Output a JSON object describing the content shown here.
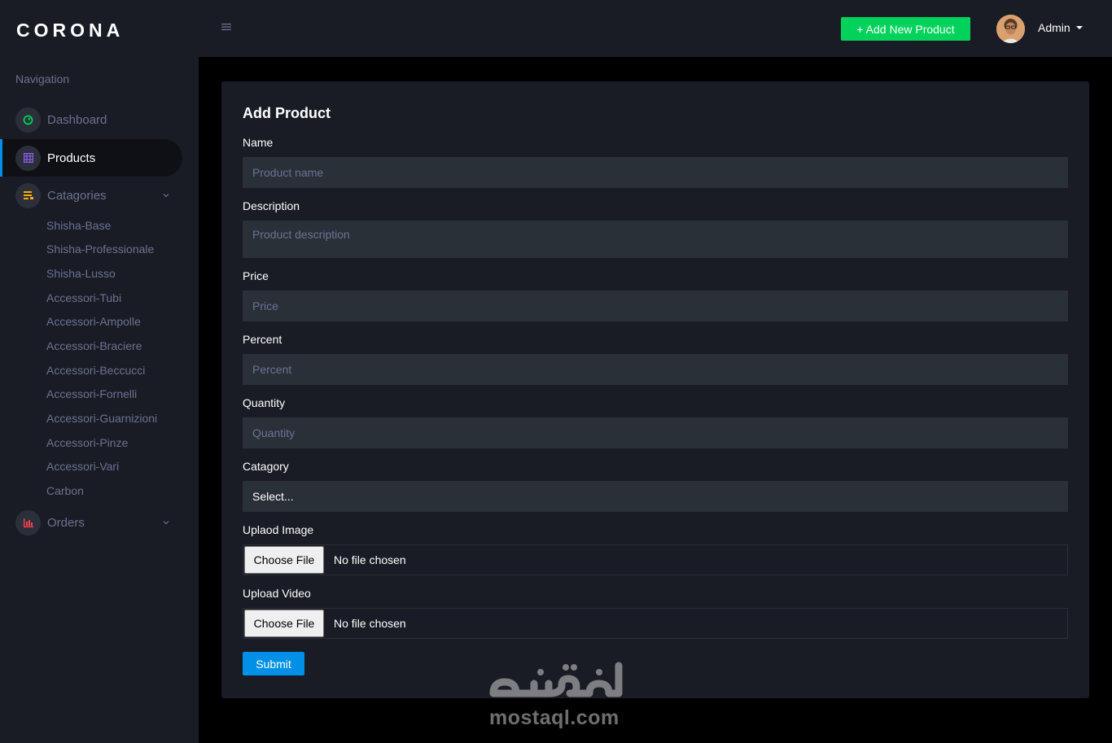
{
  "brand": "CORONA",
  "sidebar": {
    "heading": "Navigation",
    "items": [
      {
        "label": "Dashboard",
        "icon": "speedometer-icon",
        "color": "#00d25b"
      },
      {
        "label": "Products",
        "icon": "table-grid-icon",
        "color": "#8f5fe8",
        "active": true
      },
      {
        "label": "Catagories",
        "icon": "playlist-icon",
        "color": "#ffab00"
      },
      {
        "label": "Orders",
        "icon": "bar-chart-icon",
        "color": "#fc424a"
      }
    ],
    "categories": [
      "Shisha-Base",
      "Shisha-Professionale",
      "Shisha-Lusso",
      "Accessori-Tubi",
      "Accessori-Ampolle",
      "Accessori-Braciere",
      "Accessori-Beccucci",
      "Accessori-Fornelli",
      "Accessori-Guarnizioni",
      "Accessori-Pinze",
      "Accessori-Vari",
      "Carbon"
    ]
  },
  "topbar": {
    "add_button": "+ Add New Product",
    "user_name": "Admin"
  },
  "form": {
    "title": "Add Product",
    "name_label": "Name",
    "name_placeholder": "Product name",
    "description_label": "Description",
    "description_placeholder": "Product description",
    "price_label": "Price",
    "price_placeholder": "Price",
    "percent_label": "Percent",
    "percent_placeholder": "Percent",
    "quantity_label": "Quantity",
    "quantity_placeholder": "Quantity",
    "category_label": "Catagory",
    "category_value": "Select...",
    "image_label": "Uplaod Image",
    "video_label": "Upload Video",
    "file_button": "Choose File",
    "file_status": "No file chosen",
    "submit": "Submit"
  },
  "watermark": {
    "arabic": "مستقل",
    "latin": "mostaql.com"
  },
  "colors": {
    "sidebar_bg": "#191c24",
    "content_bg": "#000000",
    "input_bg": "#2a3038",
    "primary": "#0090e7",
    "success": "#00d25b",
    "muted_text": "#6c7293"
  }
}
